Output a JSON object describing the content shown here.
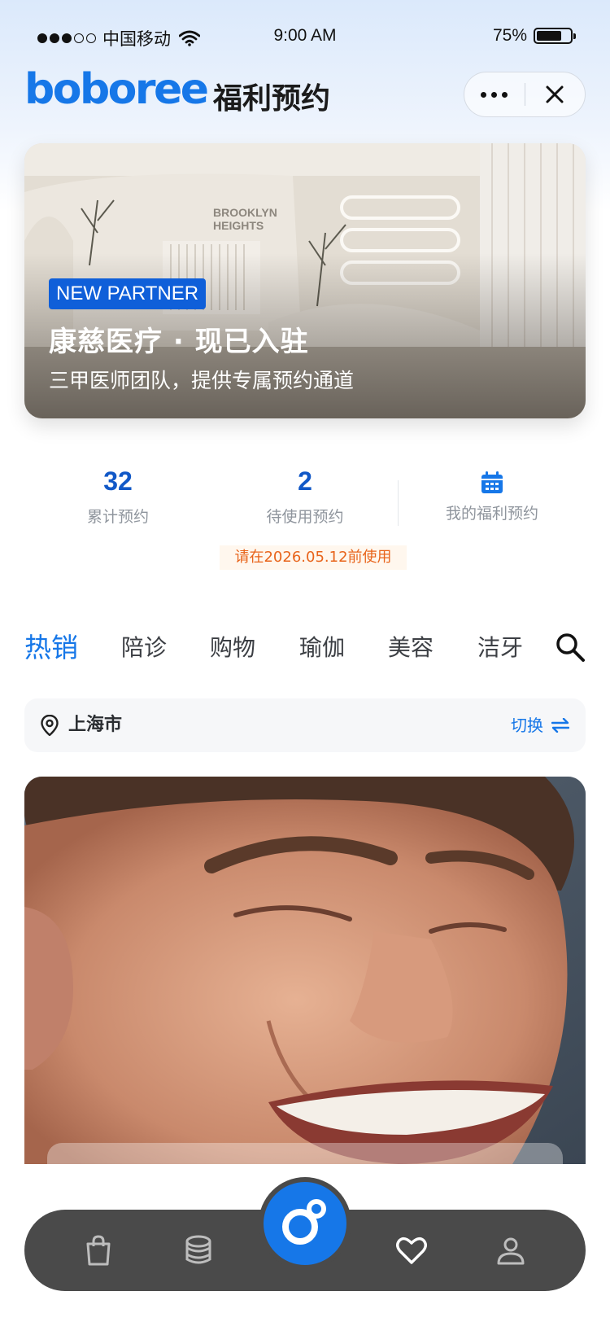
{
  "status_bar": {
    "carrier": "中国移动",
    "time": "9:00 AM",
    "battery": "75%",
    "battery_level": 0.75
  },
  "header": {
    "brand": "boboree",
    "title": "福利预约"
  },
  "banner": {
    "tag": "NEW PARTNER",
    "title": "康慈医疗 · 现已入驻",
    "subtitle": "三甲医师团队，提供专属预约通道",
    "wall_text_line1": "BROOKLYN",
    "wall_text_line2": "HEIGHTS"
  },
  "stats": {
    "total": {
      "value": "32",
      "label": "累计预约"
    },
    "pending": {
      "value": "2",
      "label": "待使用预约"
    },
    "my_bookings": {
      "label": "我的福利预约",
      "icon": "calendar-icon"
    },
    "note": "请在2026.05.12前使用"
  },
  "tabs": [
    {
      "label": "热销",
      "active": true
    },
    {
      "label": "陪诊",
      "active": false
    },
    {
      "label": "购物",
      "active": false
    },
    {
      "label": "瑜伽",
      "active": false
    },
    {
      "label": "美容",
      "active": false
    },
    {
      "label": "洁牙",
      "active": false
    }
  ],
  "location": {
    "city": "上海市",
    "switch_label": "切换"
  },
  "bottom_nav": {
    "items": [
      "shopping-bag-icon",
      "coins-stack-icon",
      "home-logo-icon",
      "heart-icon",
      "profile-icon"
    ],
    "active_color": "#1677e8",
    "bar_color": "#4a4a4a"
  },
  "colors": {
    "accent": "#1677e8",
    "stat_number": "#1158c7",
    "warning": "#e8641b"
  }
}
